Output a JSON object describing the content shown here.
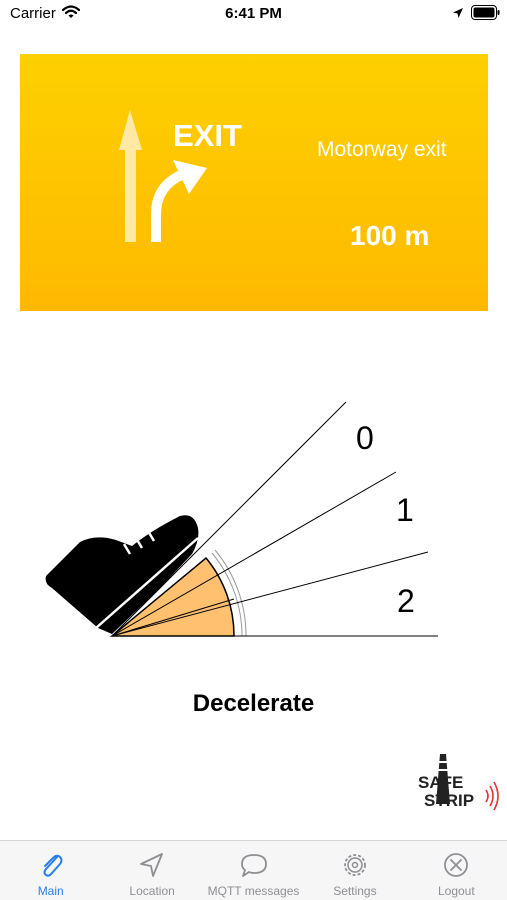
{
  "status_bar": {
    "carrier": "Carrier",
    "time": "6:41 PM"
  },
  "sign": {
    "exit_label": "EXIT",
    "destination": "Motorway exit",
    "distance": "100 m",
    "background_color": "#ffc800"
  },
  "gauge": {
    "levels": [
      "0",
      "1",
      "2"
    ],
    "fill_color": "#ffc170",
    "pedal_icon": "shoe-icon"
  },
  "status": {
    "text": "Decelerate"
  },
  "logo": {
    "line1": "SAFE",
    "line2": "STRIP"
  },
  "tabs": [
    {
      "label": "Main",
      "icon": "paperclip-icon",
      "active": true
    },
    {
      "label": "Location",
      "icon": "location-arrow-icon",
      "active": false
    },
    {
      "label": "MQTT messages",
      "icon": "speech-bubble-icon",
      "active": false
    },
    {
      "label": "Settings",
      "icon": "gear-icon",
      "active": false
    },
    {
      "label": "Logout",
      "icon": "close-circle-icon",
      "active": false
    }
  ],
  "colors": {
    "accent": "#2a7fe6",
    "inactive": "#8e8e93"
  }
}
